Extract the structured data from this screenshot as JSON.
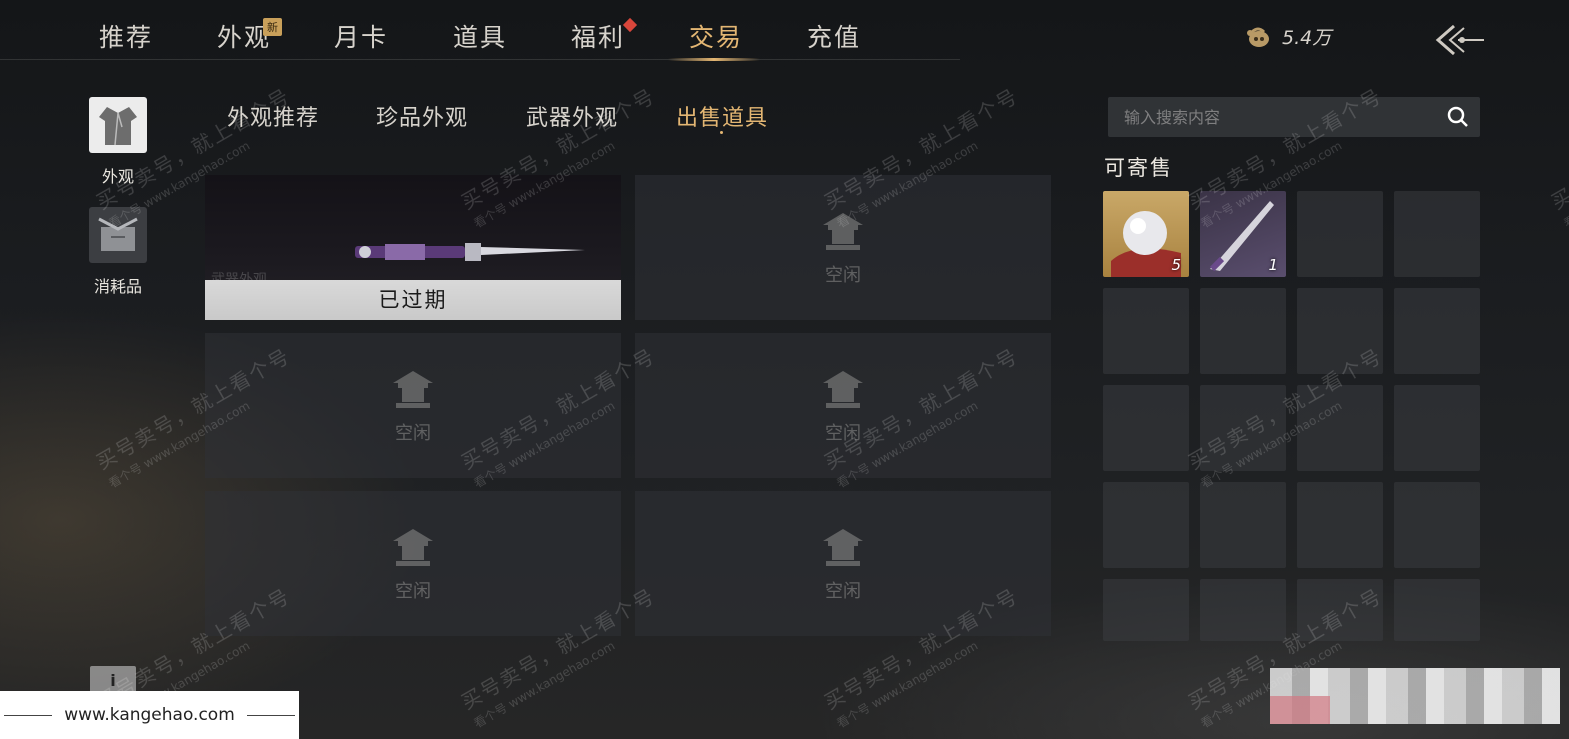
{
  "nav": {
    "tabs": [
      {
        "label": "推荐"
      },
      {
        "label": "外观",
        "badge": "新"
      },
      {
        "label": "月卡"
      },
      {
        "label": "道具"
      },
      {
        "label": "福利",
        "has_red_dot": true
      },
      {
        "label": "交易",
        "active": true
      },
      {
        "label": "充值"
      }
    ],
    "currency": {
      "icon": "coin-pouch-icon",
      "amount": "5.4万"
    },
    "back_icon": "back-arrow-icon"
  },
  "categories": [
    {
      "label": "外观",
      "icon": "robe-icon",
      "active": true
    },
    {
      "label": "消耗品",
      "icon": "package-icon"
    }
  ],
  "subtabs": [
    {
      "label": "外观推荐"
    },
    {
      "label": "珍品外观"
    },
    {
      "label": "武器外观"
    },
    {
      "label": "出售道具",
      "active": true
    }
  ],
  "listings": [
    {
      "item": "weapon-blade",
      "faded_label": "武器外观",
      "status": "已过期"
    },
    {
      "status_empty": "空闲"
    },
    {
      "status_empty": "空闲"
    },
    {
      "status_empty": "空闲"
    },
    {
      "status_empty": "空闲"
    },
    {
      "status_empty": "空闲"
    }
  ],
  "search": {
    "placeholder": "输入搜索内容",
    "icon": "search-icon"
  },
  "sellable": {
    "title": "可寄售",
    "items": [
      {
        "icon": "pearl-icon",
        "count": "5"
      },
      {
        "icon": "blade-icon",
        "count": "1"
      }
    ],
    "total_slots": 20
  },
  "watermark": {
    "line1": "买号卖号，就上看个号",
    "line2": "www.kangehao.com",
    "brand": "看个号"
  },
  "footer": {
    "site": "www.kangehao.com"
  },
  "colors": {
    "accent": "#e3b673",
    "alert": "#d9463b"
  }
}
